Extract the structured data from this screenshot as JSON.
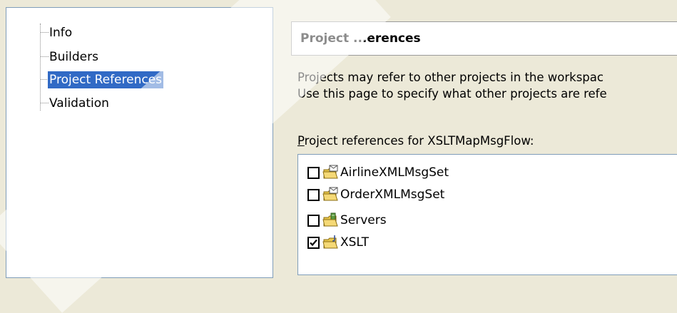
{
  "tree": {
    "items": [
      {
        "label": "Info",
        "selected": false
      },
      {
        "label": "Builders",
        "selected": false
      },
      {
        "label": "Project References",
        "selected": true
      },
      {
        "label": "Validation",
        "selected": false
      }
    ]
  },
  "page": {
    "title": "Project ...erences",
    "description_lines": [
      "Projects may refer to other projects in the workspac",
      "Use this page to specify what other projects are refe"
    ],
    "refs_label_mnemonic": "P",
    "refs_label_rest": "roject references for XSLTMapMsgFlow:"
  },
  "references": [
    {
      "name": "AirlineXMLMsgSet",
      "checked": false,
      "icon": "msgset-project-folder-icon"
    },
    {
      "name": "OrderXMLMsgSet",
      "checked": false,
      "icon": "msgset-project-folder-icon"
    },
    {
      "name": "Servers",
      "checked": false,
      "icon": "server-project-folder-icon"
    },
    {
      "name": "XSLT",
      "checked": true,
      "icon": "java-project-folder-icon"
    }
  ],
  "colors": {
    "selection": "#316ac5",
    "folder": "#e8c64a",
    "background": "#ece9d8"
  }
}
